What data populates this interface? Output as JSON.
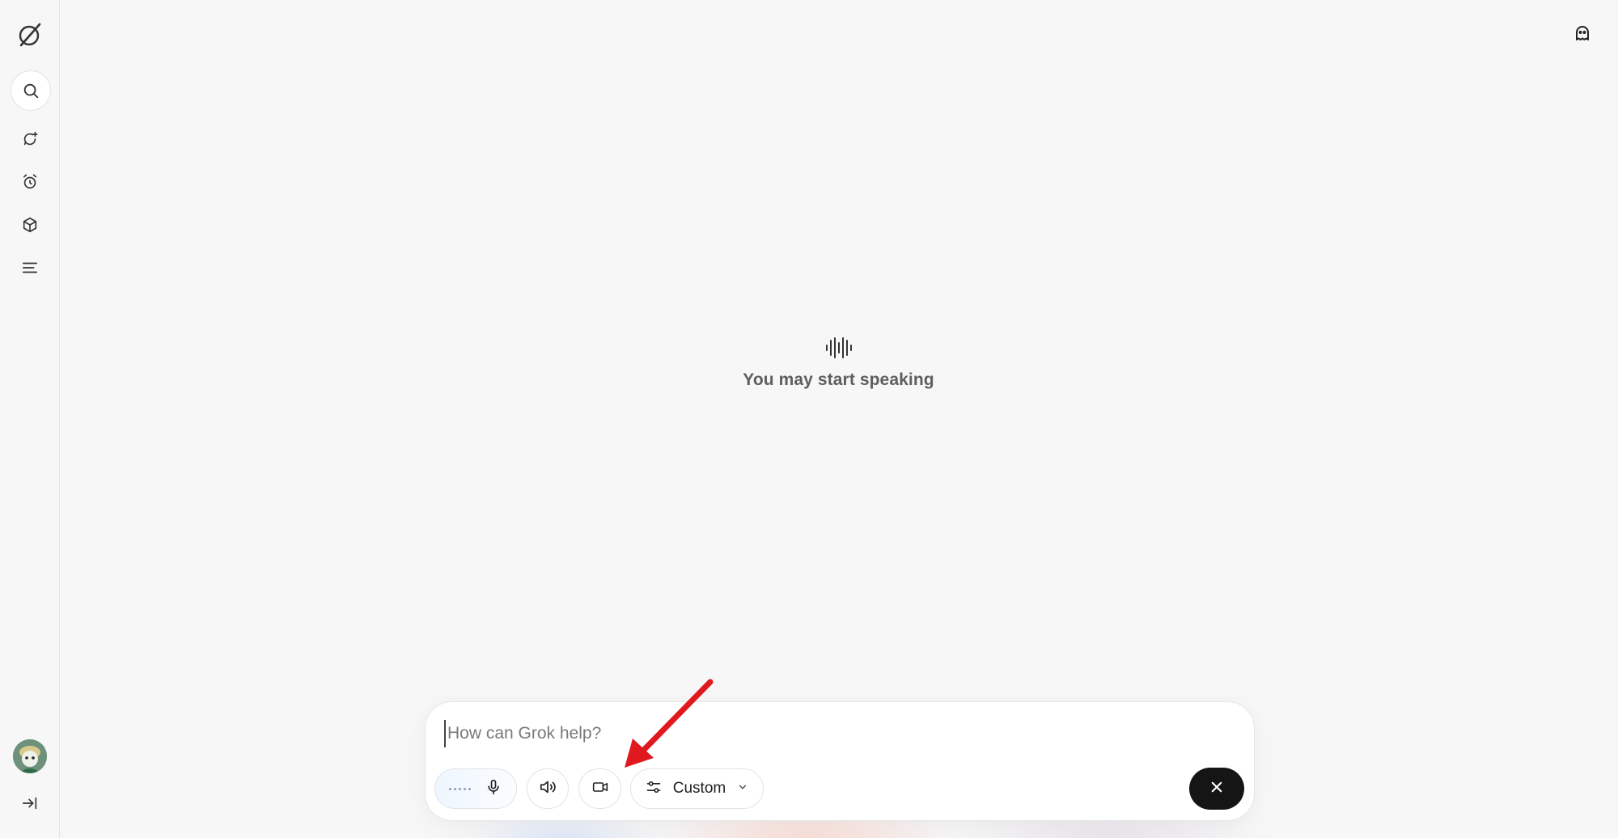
{
  "sidebar": {
    "logo_icon": "grok-logo-icon",
    "items": [
      {
        "icon": "search-icon",
        "name": "search"
      },
      {
        "icon": "new-chat-icon",
        "name": "chat"
      },
      {
        "icon": "alarm-clock-icon",
        "name": "tasks"
      },
      {
        "icon": "cube-icon",
        "name": "projects"
      },
      {
        "icon": "menu-lines-icon",
        "name": "history"
      }
    ],
    "avatar_icon": "user-avatar",
    "expand_icon": "expand-sidebar-icon"
  },
  "header": {
    "private_icon": "ghost-icon"
  },
  "voice_status": {
    "icon": "sound-wave-icon",
    "text": "You may start speaking"
  },
  "composer": {
    "placeholder": "How can Grok help?",
    "mic_icon": "microphone-icon",
    "speaker_icon": "speaker-icon",
    "camera_icon": "video-camera-icon",
    "mode_icon": "sliders-icon",
    "mode_label": "Custom",
    "mode_chevron": "chevron-down-icon",
    "close_icon": "close-icon"
  },
  "colors": {
    "background": "#f7f7f7",
    "close_button": "#151515",
    "annotation_arrow": "#e0191e"
  }
}
